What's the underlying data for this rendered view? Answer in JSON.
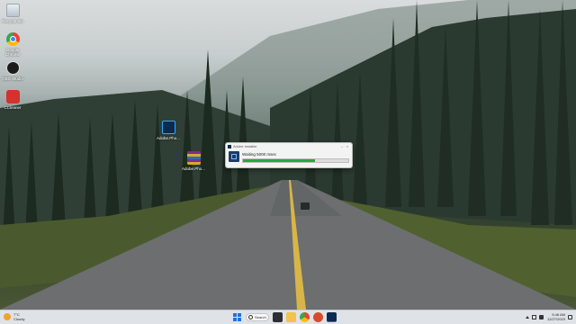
{
  "desktop": {
    "icons": [
      {
        "label": "Recycle Bin",
        "icon": "recycle-bin-icon"
      },
      {
        "label": "Google Chrome",
        "icon": "chrome-icon"
      },
      {
        "label": "OBS Studio",
        "icon": "obs-icon"
      },
      {
        "label": "CCleaner",
        "icon": "ccleaner-icon"
      },
      {
        "label": "Adobe.Pho...",
        "icon": "photoshop-icon"
      },
      {
        "label": "Adobe.Pho...",
        "icon": "winrar-archive-icon"
      }
    ]
  },
  "dialog": {
    "title": "Adobe Installer",
    "status": "Waiting 5000 msec",
    "progress_percent": 68,
    "accent_color": "#27a845"
  },
  "taskbar": {
    "weather_temp": "7°C",
    "weather_desc": "Cloudy",
    "search_label": "Search",
    "time": "5:46 AM",
    "date": "12/27/2023",
    "apps": [
      "file-explorer-icon",
      "folder-icon",
      "chrome-icon",
      "paint-icon",
      "installer-icon"
    ]
  }
}
